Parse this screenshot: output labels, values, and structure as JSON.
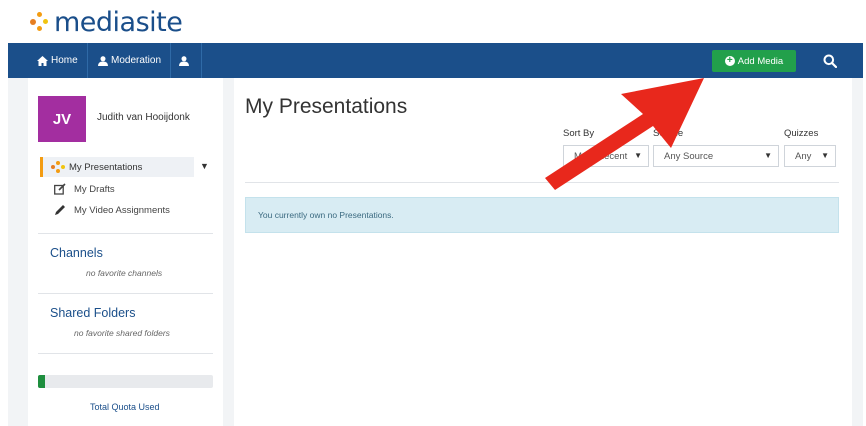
{
  "logo": {
    "text": "mediasite"
  },
  "navbar": {
    "home_label": "Home",
    "moderation_label": "Moderation",
    "add_media_label": "Add Media"
  },
  "user": {
    "initials": "JV",
    "name": "Judith van Hooijdonk"
  },
  "sidebar": {
    "active_item": "My Presentations",
    "links": [
      {
        "label": "My Drafts",
        "icon": "edit-icon"
      },
      {
        "label": "My Video Assignments",
        "icon": "pencil-icon"
      }
    ],
    "channels": {
      "heading": "Channels",
      "empty": "no favorite channels"
    },
    "shared_folders": {
      "heading": "Shared Folders",
      "empty": "no favorite shared folders"
    },
    "quota": {
      "label": "Total Quota Used",
      "used_fraction": 0.04
    }
  },
  "main": {
    "title": "My Presentations",
    "filters": {
      "sort_by": {
        "label": "Sort By",
        "value": "Most Recent"
      },
      "source": {
        "label": "Source",
        "value": "Any Source"
      },
      "quizzes": {
        "label": "Quizzes",
        "value": "Any"
      }
    },
    "info_message": "You currently own no Presentations."
  },
  "colors": {
    "navbar": "#1b4f8a",
    "add_media": "#22a04b",
    "avatar": "#a32ea0",
    "accent": "#f39c12",
    "info_bg": "#d8ecf3",
    "annotation_arrow": "#e8281c"
  }
}
